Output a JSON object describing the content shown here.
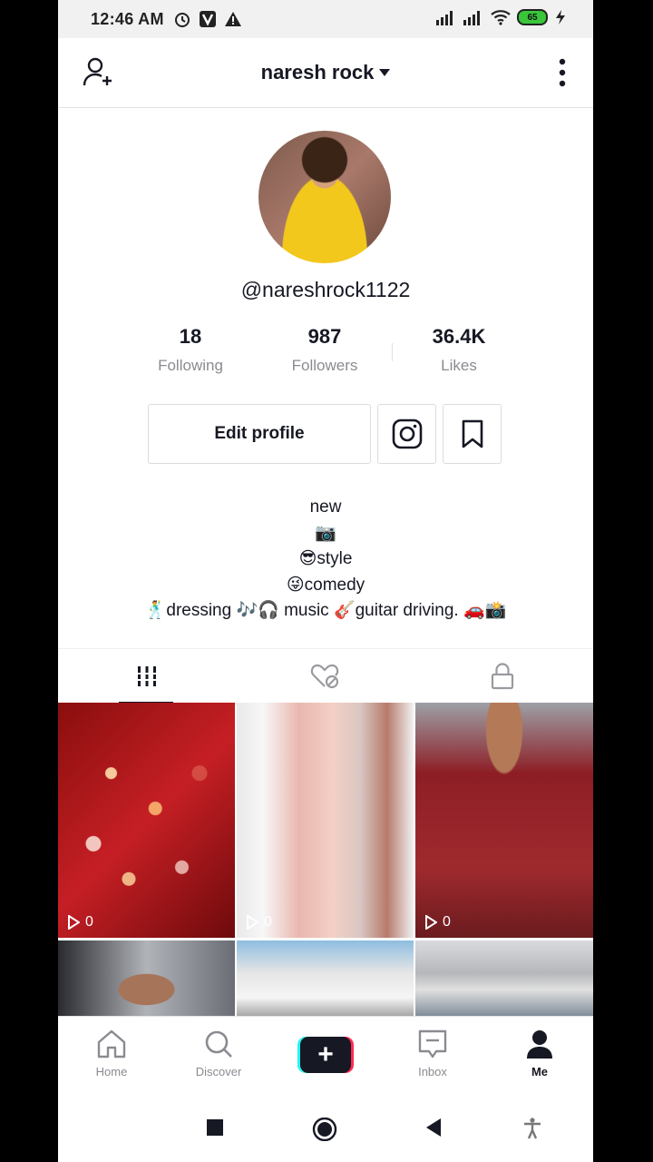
{
  "status_bar": {
    "time": "12:46 AM",
    "battery": "65"
  },
  "header": {
    "title": "naresh rock"
  },
  "profile": {
    "username": "@nareshrock1122",
    "stats": [
      {
        "value": "18",
        "label": "Following"
      },
      {
        "value": "987",
        "label": "Followers"
      },
      {
        "value": "36.4K",
        "label": "Likes"
      }
    ],
    "edit_label": "Edit profile",
    "bio_lines": [
      "new",
      "📷",
      "😎style",
      "😜comedy",
      "🕺dressing 🎶🎧 music 🎸guitar driving. 🚗📸"
    ]
  },
  "grid": {
    "views": [
      "0",
      "0",
      "0"
    ]
  },
  "bottom_nav": {
    "items": [
      {
        "label": "Home"
      },
      {
        "label": "Discover"
      },
      {
        "label": "Inbox"
      },
      {
        "label": "Me"
      }
    ],
    "create_symbol": "+"
  },
  "colors": {
    "accent_red": "#fe2c55",
    "accent_cyan": "#25f4ee",
    "text_dark": "#161823",
    "text_muted": "#8a8b91"
  }
}
